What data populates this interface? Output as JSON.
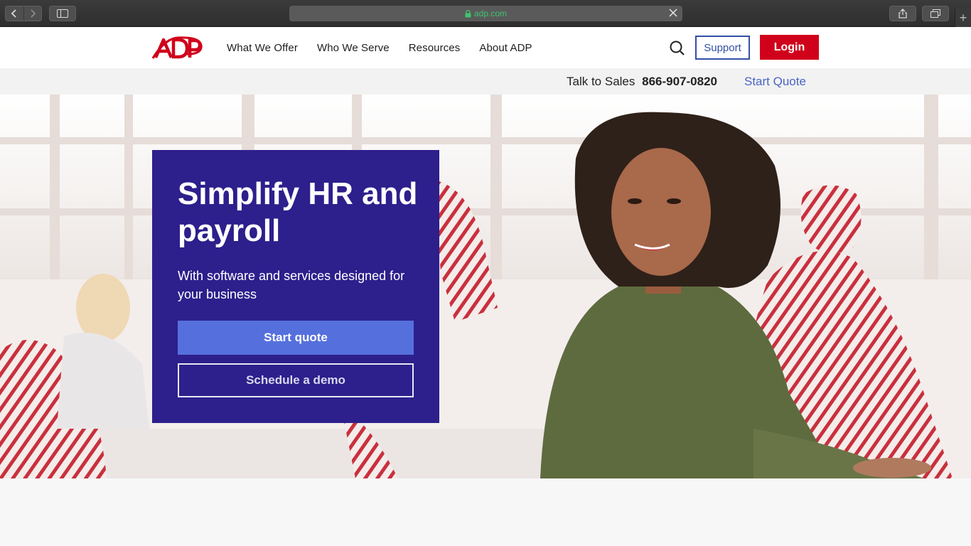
{
  "browser": {
    "url": "adp.com"
  },
  "header": {
    "nav": [
      "What We Offer",
      "Who We Serve",
      "Resources",
      "About ADP"
    ],
    "support_label": "Support",
    "login_label": "Login"
  },
  "salesbar": {
    "talk_label": "Talk to Sales",
    "phone": "866-907-0820",
    "start_quote": "Start Quote"
  },
  "hero": {
    "headline": "Simplify HR and payroll",
    "subhead": "With software and services designed for your business",
    "primary_cta": "Start quote",
    "secondary_cta": "Schedule a demo"
  },
  "colors": {
    "brand_red": "#d0021b",
    "promo_bg": "#2d1f8c",
    "cta_blue": "#5570dd",
    "link_blue": "#4a64c4"
  }
}
